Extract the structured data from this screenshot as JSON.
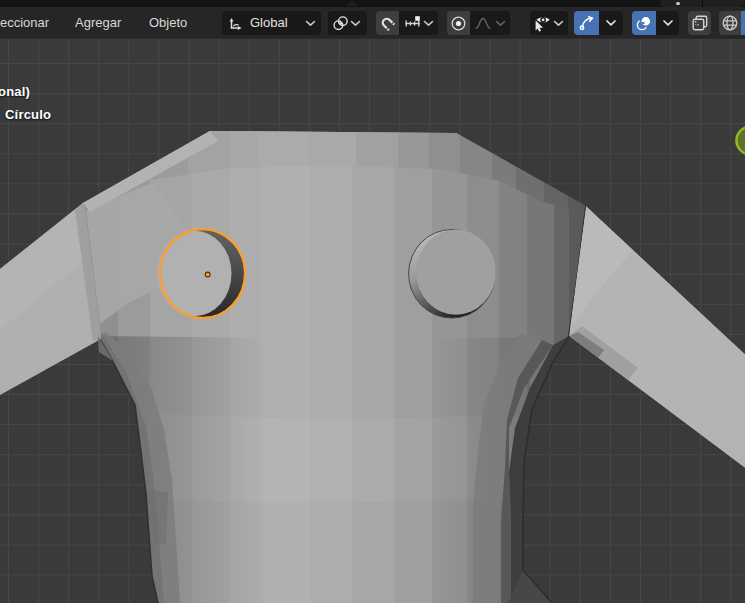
{
  "header": {
    "menus": [
      {
        "label": "eccionar"
      },
      {
        "label": "Agregar"
      },
      {
        "label": "Objeto"
      }
    ],
    "transform_orientation": {
      "value": "Global"
    },
    "controls": {
      "pivot_point": "pivot-point-dropdown",
      "snapping": "snap-toggle-and-menu",
      "proportional_editing": "proportional-edit-toggle-and-falloff",
      "object_type_visibility": "visibility-dropdown",
      "show_gizmo": "gizmo-toggle-on",
      "show_overlays": "overlays-toggle-on",
      "toggle_xray": "xray-toggle",
      "viewport_shading": [
        "wireframe",
        "solid-active"
      ]
    }
  },
  "viewport": {
    "overlay_line1": "onal)",
    "overlay_line2": "Círculo",
    "selected_object": "Círculo"
  },
  "colors": {
    "topstrip": "#131313",
    "header": "#262626",
    "btn": "#191919",
    "toggle": "#3e3e3e",
    "blue": "#4772b3",
    "vpbg": "#3a3a3a",
    "grid": "#474747",
    "selection_outline": "#ff9d2b",
    "origin_dot": "#ffa028",
    "nav_ball_green": "#93b42c"
  }
}
